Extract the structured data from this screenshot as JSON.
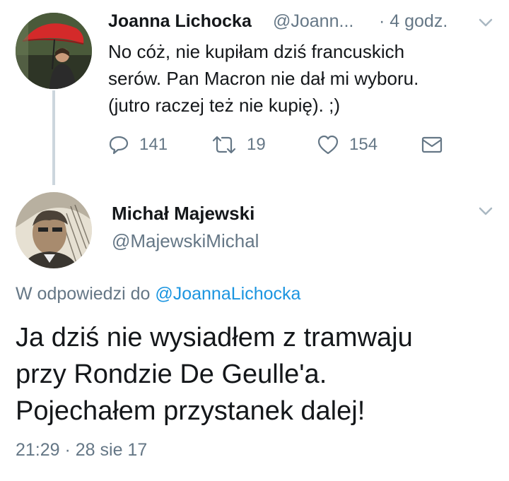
{
  "tweet1": {
    "author_name": "Joanna Lichocka",
    "author_handle": "@Joann...",
    "time": "· 4 godz.",
    "text_lines": [
      "No cóż, nie kupiłam dziś francuskich",
      "serów. Pan Macron nie dał mi wyboru.",
      "(jutro raczej też nie  kupię). ;)"
    ],
    "replies": "141",
    "retweets": "19",
    "likes": "154"
  },
  "tweet2": {
    "author_name": "Michał Majewski",
    "author_handle": "@MajewskiMichal",
    "reply_prefix": "W odpowiedzi do",
    "reply_mention": "@JoannaLichocka",
    "text_lines": [
      "Ja dziś nie wysiadłem z tramwaju",
      "przy Rondzie De Geulle'a.",
      "Pojechałem przystanek dalej!"
    ],
    "timestamp": "21:29 · 28 sie 17"
  },
  "colors": {
    "text": "#14171a",
    "muted": "#657786",
    "link": "#1b95e0",
    "thread_line": "#ccd6dd"
  },
  "icons": [
    "reply-icon",
    "retweet-icon",
    "like-icon",
    "dm-icon",
    "chevron-down-icon"
  ]
}
